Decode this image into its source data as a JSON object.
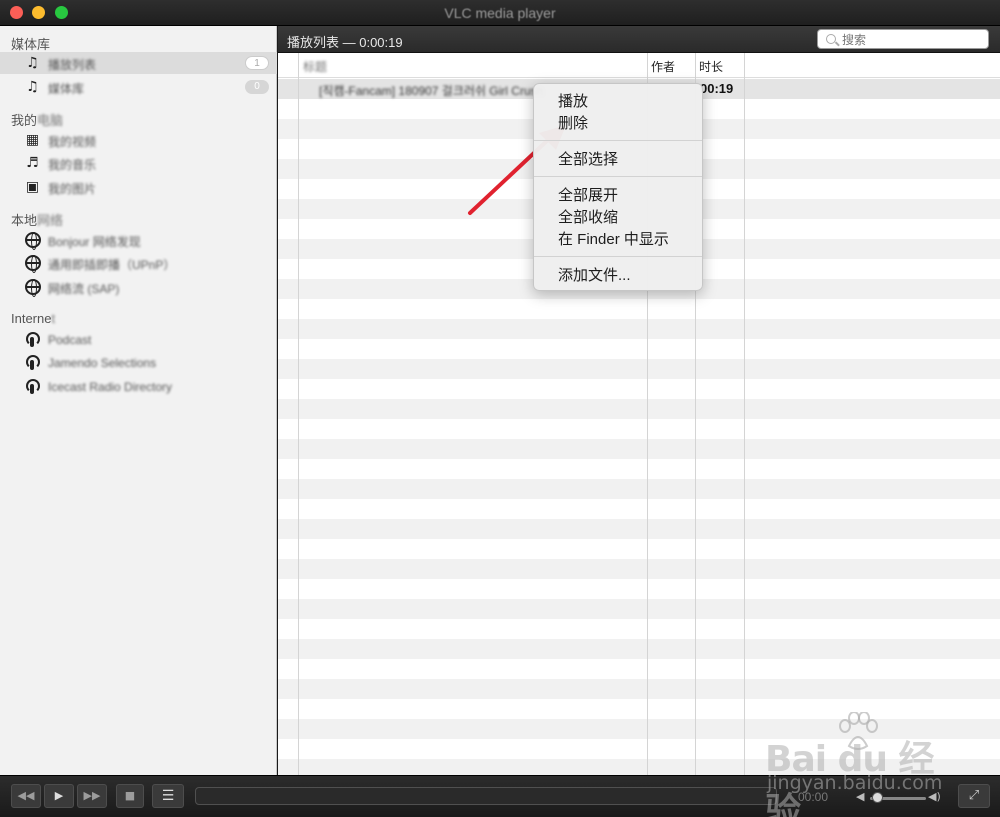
{
  "window": {
    "title": "VLC media player"
  },
  "sidebar": {
    "sections": [
      {
        "title": "媒体库",
        "title_blur": ""
      },
      {
        "title": "我的",
        "title_blur": "电脑"
      },
      {
        "title": "本地",
        "title_blur": "网络"
      },
      {
        "title": "Interne",
        "title_blur": "t"
      }
    ],
    "items": [
      {
        "label": "播放列表",
        "badge": "1",
        "icon": "music-note-icon"
      },
      {
        "label": "媒体库",
        "badge": "0",
        "icon": "music-note-icon"
      },
      {
        "label": "我的视频",
        "icon": "film-icon"
      },
      {
        "label": "我的音乐",
        "icon": "music-notes-icon"
      },
      {
        "label": "我的图片",
        "icon": "picture-icon"
      },
      {
        "label": "Bonjour 网络发现",
        "icon": "globe-icon"
      },
      {
        "label": "通用即插即播（UPnP）",
        "icon": "globe-icon"
      },
      {
        "label": "网络流 (SAP)",
        "icon": "globe-icon"
      },
      {
        "label": "Podcast",
        "icon": "podcast-icon"
      },
      {
        "label": "Jamendo Selections",
        "icon": "podcast-icon"
      },
      {
        "label": "Icecast Radio Directory",
        "icon": "podcast-icon"
      }
    ]
  },
  "main": {
    "title": "播放列表 — 0:00:19",
    "search": {
      "placeholder": "搜索"
    },
    "columns": {
      "title": "标题",
      "author": "作者",
      "duration": "时长"
    },
    "rows": [
      {
        "title": "[직캠-Fancam] 180907 걸크러쉬 Girl Crush",
        "author": "",
        "duration": "00:19"
      }
    ]
  },
  "context_menu": {
    "items": [
      "播放",
      "删除",
      "全部选择",
      "全部展开",
      "全部收缩",
      "在 Finder 中显示",
      "添加文件..."
    ]
  },
  "controls": {
    "time": "00:00",
    "volume": 0.1
  },
  "watermark": {
    "brand": "Bai du 经验",
    "url": "jingyan.baidu.com"
  },
  "colors": {
    "arrow": "#e0222f",
    "titlebar": "#242424",
    "sidebar_bg": "#f2f2f2"
  }
}
